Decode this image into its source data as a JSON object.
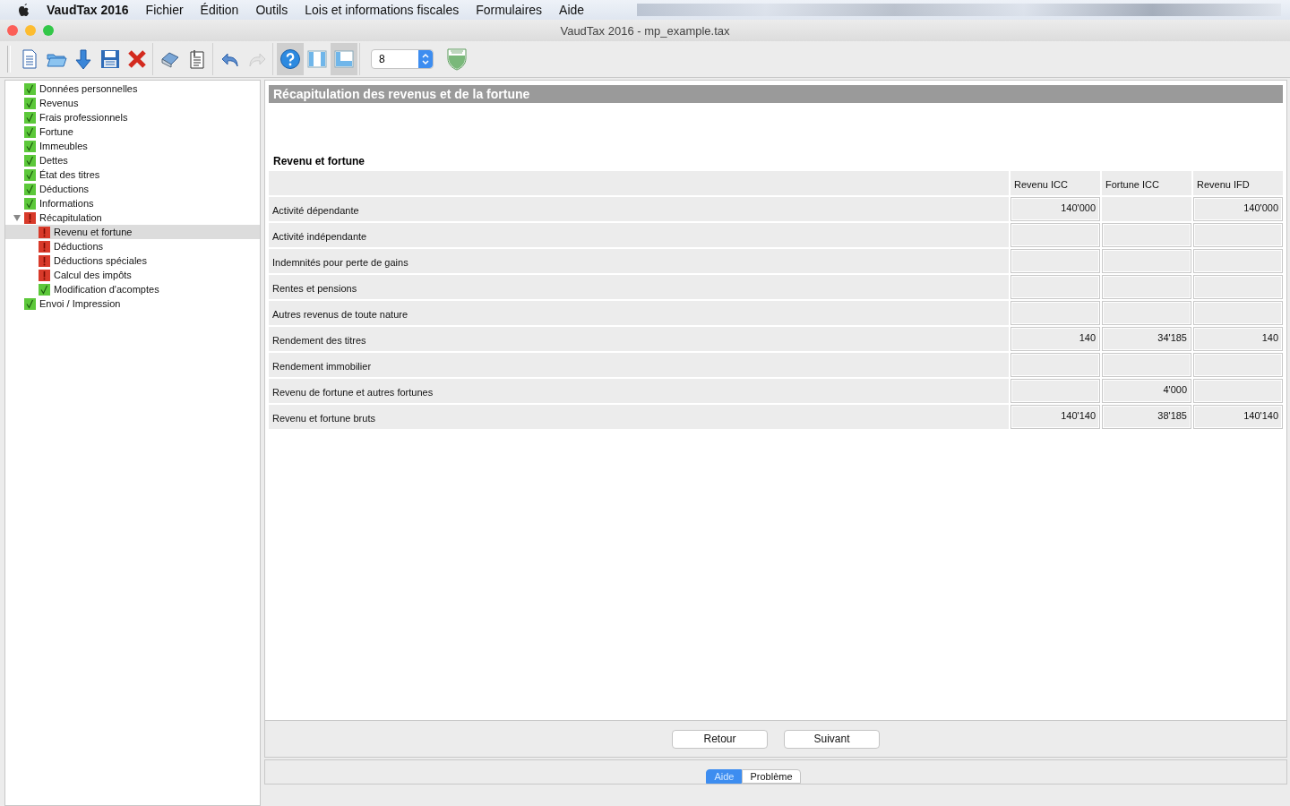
{
  "menu_bar": {
    "app": "VaudTax 2016",
    "items": [
      "Fichier",
      "Édition",
      "Outils",
      "Lois et informations fiscales",
      "Formulaires",
      "Aide"
    ]
  },
  "window": {
    "title": "VaudTax 2016 - mp_example.tax"
  },
  "toolbar": {
    "groups": [
      [
        {
          "kind": "new",
          "pressed": false,
          "disabled": false
        },
        {
          "kind": "open",
          "pressed": false,
          "disabled": false
        },
        {
          "kind": "download",
          "pressed": false,
          "disabled": false
        },
        {
          "kind": "save",
          "pressed": false,
          "disabled": false
        },
        {
          "kind": "delete",
          "pressed": false,
          "disabled": false
        }
      ],
      [
        {
          "kind": "print",
          "pressed": false,
          "disabled": false
        },
        {
          "kind": "document",
          "pressed": false,
          "disabled": false
        }
      ],
      [
        {
          "kind": "undo",
          "pressed": false,
          "disabled": false
        },
        {
          "kind": "redo",
          "pressed": false,
          "disabled": true
        }
      ],
      [
        {
          "kind": "help",
          "pressed": true,
          "disabled": false
        },
        {
          "kind": "columns",
          "pressed": false,
          "disabled": false
        },
        {
          "kind": "panel",
          "pressed": true,
          "disabled": false
        }
      ]
    ],
    "zoom_select": "8"
  },
  "sidebar": {
    "items": [
      {
        "label": "Données personnelles",
        "complete": true,
        "selected": false
      },
      {
        "label": "Revenus",
        "complete": true,
        "selected": false
      },
      {
        "label": "Frais professionnels",
        "complete": true,
        "selected": false
      },
      {
        "label": "Fortune",
        "complete": true,
        "selected": false
      },
      {
        "label": "Immeubles",
        "complete": true,
        "selected": false
      },
      {
        "label": "Dettes",
        "complete": true,
        "selected": false
      },
      {
        "label": "État des titres",
        "complete": true,
        "selected": false
      },
      {
        "label": "Déductions",
        "complete": true,
        "selected": false
      },
      {
        "label": "Informations",
        "complete": true,
        "selected": false
      },
      {
        "label": "Récapitulation",
        "complete": false,
        "selected": false,
        "expanded": true,
        "children": [
          {
            "label": "Revenu et fortune",
            "complete": false,
            "selected": true
          },
          {
            "label": "Déductions",
            "complete": false,
            "selected": false
          },
          {
            "label": "Déductions spéciales",
            "complete": false,
            "selected": false
          },
          {
            "label": "Calcul des impôts",
            "complete": false,
            "selected": false
          },
          {
            "label": "Modification d'acomptes",
            "complete": true,
            "selected": false
          }
        ]
      },
      {
        "label": "Envoi / Impression",
        "complete": true,
        "selected": false
      }
    ]
  },
  "page": {
    "title": "Récapitulation des revenus et de la fortune",
    "section": "Revenu et fortune",
    "table": {
      "columns": [
        "Revenu ICC",
        "Fortune ICC",
        "Revenu IFD"
      ],
      "rows": [
        {
          "label": "Activité dépendante",
          "cells": [
            "140'000",
            null,
            "140'000"
          ]
        },
        {
          "label": "Activité indépendante",
          "cells": [
            "",
            "",
            ""
          ]
        },
        {
          "label": "Indemnités pour perte de gains",
          "cells": [
            "",
            "",
            ""
          ]
        },
        {
          "label": "Rentes et pensions",
          "cells": [
            "",
            "",
            ""
          ]
        },
        {
          "label": "Autres revenus de toute nature",
          "cells": [
            "",
            "",
            ""
          ]
        },
        {
          "label": "Rendement des titres",
          "cells": [
            "140",
            "34'185",
            "140"
          ]
        },
        {
          "label": "Rendement immobilier",
          "cells": [
            "",
            "",
            ""
          ]
        },
        {
          "label": "Revenu de fortune et autres fortunes",
          "cells": [
            "",
            "4'000",
            ""
          ]
        },
        {
          "label": "Revenu et fortune bruts",
          "cells": [
            "140'140",
            "38'185",
            "140'140"
          ]
        }
      ]
    }
  },
  "buttons": [
    "Retour",
    "Suivant"
  ],
  "bottom_tabs": [
    {
      "label": "Aide",
      "selected": true
    },
    {
      "label": "Problème",
      "selected": false
    }
  ]
}
